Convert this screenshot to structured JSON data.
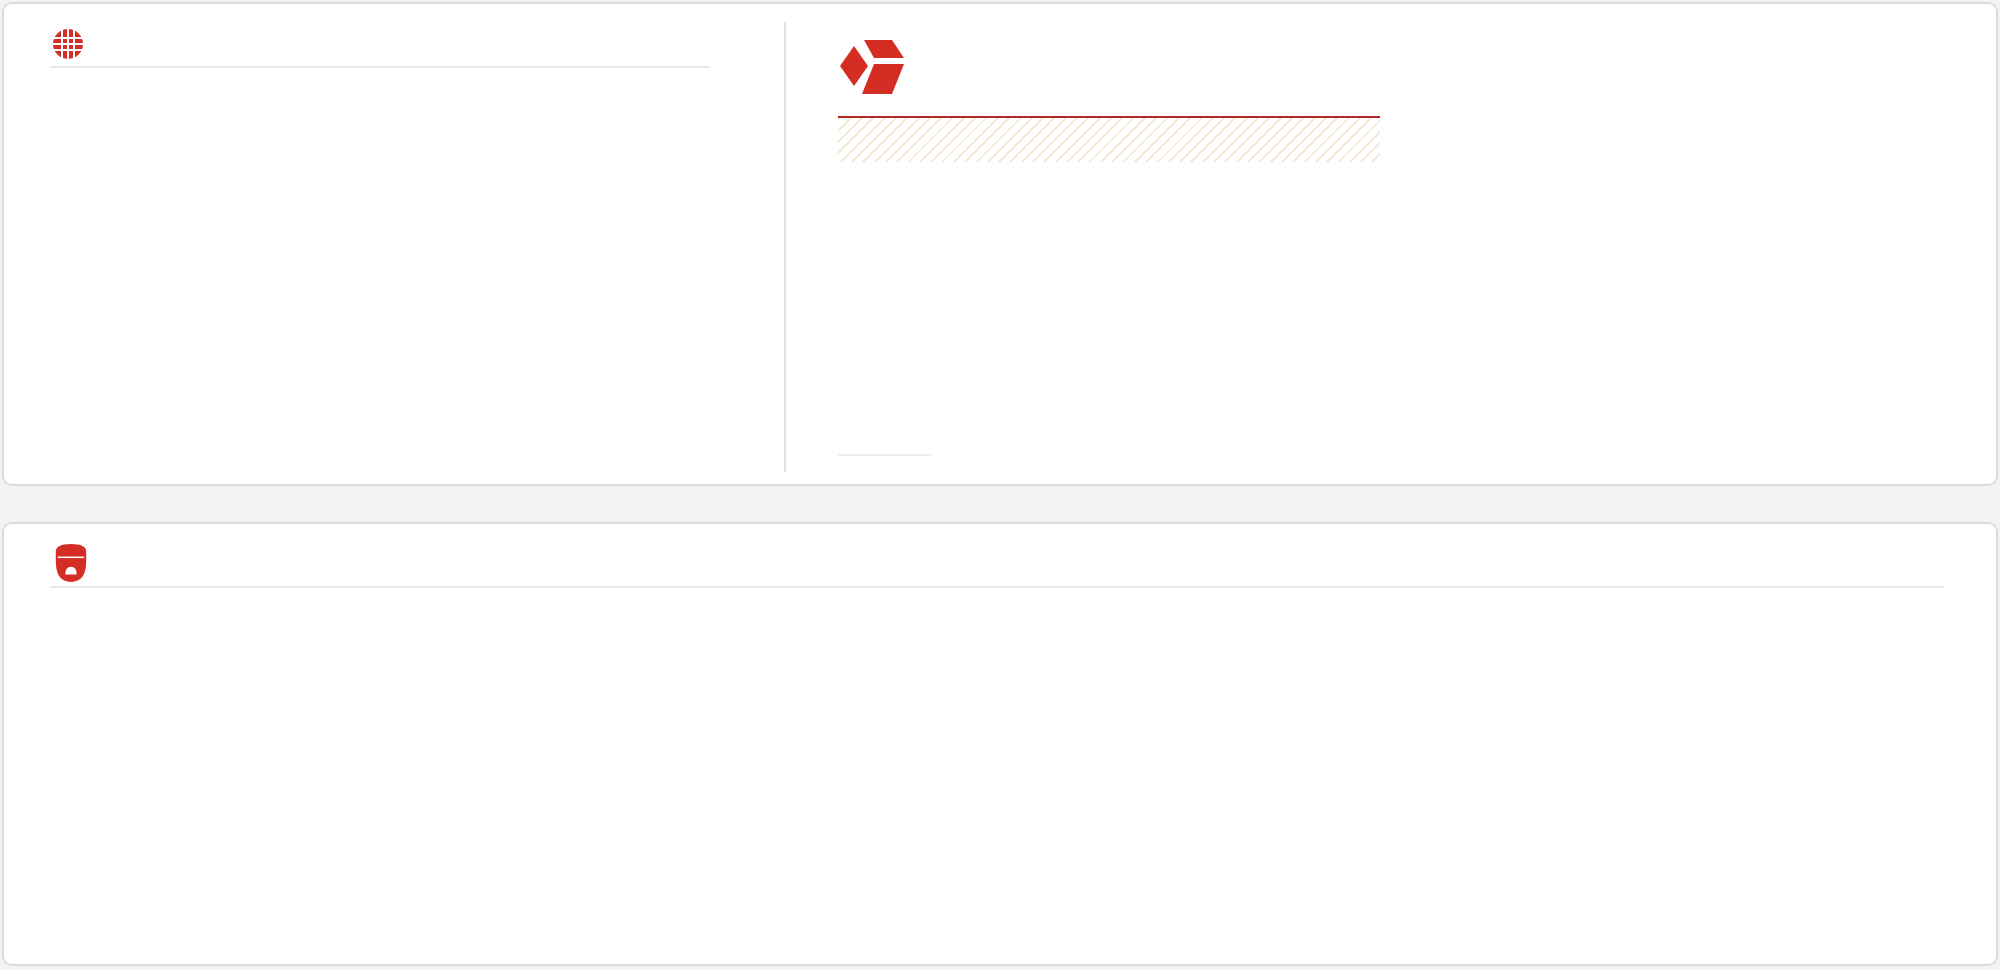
{
  "sections": [
    {
      "kind": "globe"
    },
    {
      "kind": "cube"
    },
    {
      "kind": "camera"
    }
  ]
}
